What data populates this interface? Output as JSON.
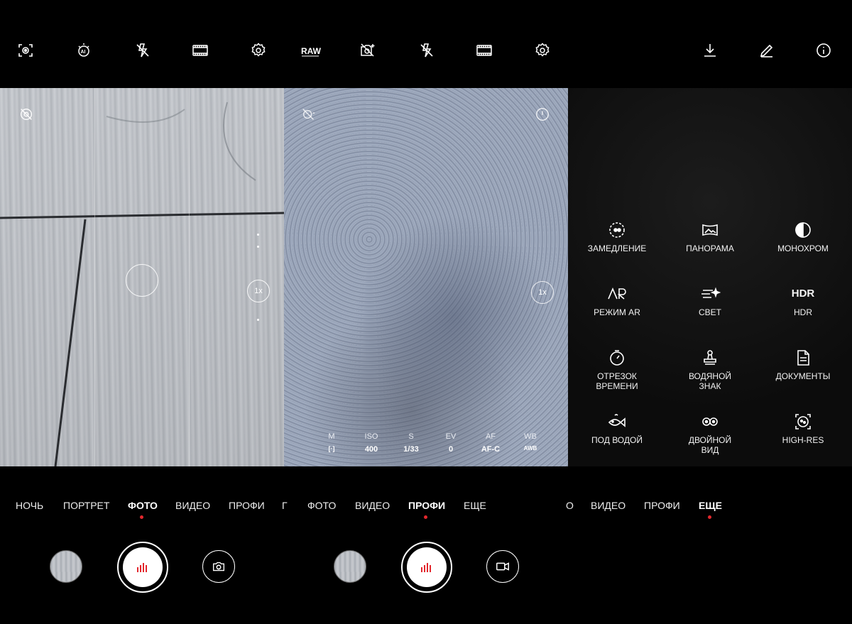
{
  "panel1": {
    "zoom": "1x",
    "modes": [
      {
        "label": "НОЧЬ",
        "active": false
      },
      {
        "label": "ПОРТРЕТ",
        "active": false
      },
      {
        "label": "ФОТО",
        "active": true
      },
      {
        "label": "ВИДЕО",
        "active": false
      },
      {
        "label": "ПРОФИ",
        "active": false
      },
      {
        "label": "Г",
        "active": false
      }
    ]
  },
  "panel2": {
    "raw_label": "RAW",
    "zoom": "1x",
    "pro_settings": [
      {
        "key": "M",
        "value": "[·]"
      },
      {
        "key": "ISO",
        "value": "400"
      },
      {
        "key": "S",
        "value": "1/33"
      },
      {
        "key": "EV",
        "value": "0"
      },
      {
        "key": "AF",
        "value": "AF-C"
      },
      {
        "key": "WB",
        "value": "AWB"
      }
    ],
    "modes": [
      {
        "label": "ФОТО",
        "active": false
      },
      {
        "label": "ВИДЕО",
        "active": false
      },
      {
        "label": "ПРОФИ",
        "active": true
      },
      {
        "label": "ЕЩЕ",
        "active": false
      }
    ]
  },
  "panel3": {
    "menu": [
      {
        "icon": "slow-motion-icon",
        "label": "ЗАМЕДЛЕНИЕ"
      },
      {
        "icon": "panorama-icon",
        "label": "ПАНОРАМА"
      },
      {
        "icon": "monochrome-icon",
        "label": "МОНОХРОМ"
      },
      {
        "icon": "ar-icon",
        "label": "РЕЖИМ AR"
      },
      {
        "icon": "light-icon",
        "label": "СВЕТ"
      },
      {
        "icon": "hdr-icon",
        "label": "HDR",
        "icon_text": "HDR"
      },
      {
        "icon": "timelapse-icon",
        "label": "ОТРЕЗОК ВРЕМЕНИ"
      },
      {
        "icon": "watermark-icon",
        "label": "ВОДЯНОЙ ЗНАК"
      },
      {
        "icon": "documents-icon",
        "label": "ДОКУМЕНТЫ"
      },
      {
        "icon": "underwater-icon",
        "label": "ПОД ВОДОЙ"
      },
      {
        "icon": "dual-view-icon",
        "label": "ДВОЙНОЙ ВИД"
      },
      {
        "icon": "high-res-icon",
        "label": "HIGH-RES"
      }
    ],
    "modes": [
      {
        "label": "О",
        "active": false
      },
      {
        "label": "ВИДЕО",
        "active": false
      },
      {
        "label": "ПРОФИ",
        "active": false
      },
      {
        "label": "ЕЩЕ",
        "active": true
      }
    ]
  },
  "colors": {
    "accent_red": "#e3272d",
    "background": "#000000"
  }
}
